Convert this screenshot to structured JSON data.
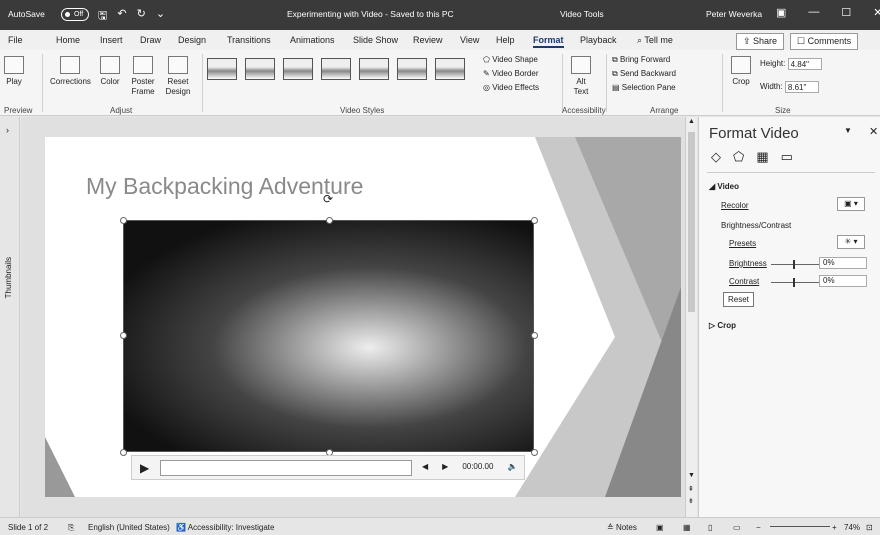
{
  "titlebar": {
    "autosave": "AutoSave",
    "toggle": "Off",
    "title": "Experimenting with Video  -  Saved to this PC",
    "tools": "Video Tools",
    "user": "Peter Weverka"
  },
  "tabs": [
    "File",
    "Home",
    "Insert",
    "Draw",
    "Design",
    "Transitions",
    "Animations",
    "Slide Show",
    "Review",
    "View",
    "Help",
    "Format",
    "Playback"
  ],
  "tell_me": "Tell me",
  "share": "Share",
  "comments": "Comments",
  "ribbon": {
    "play": "Play",
    "corrections": "Corrections",
    "color": "Color",
    "poster": "Poster Frame",
    "reset_design": "Reset Design",
    "video_shape": "Video Shape",
    "video_border": "Video Border",
    "video_effects": "Video Effects",
    "alt_text": "Alt Text",
    "bring_forward": "Bring Forward",
    "send_backward": "Send Backward",
    "selection_pane": "Selection Pane",
    "crop": "Crop",
    "height_label": "Height:",
    "height_value": "4.84\"",
    "width_label": "Width:",
    "width_value": "8.61\"",
    "groups": {
      "preview": "Preview",
      "adjust": "Adjust",
      "video_styles": "Video Styles",
      "accessibility": "Accessibility",
      "arrange": "Arrange",
      "size": "Size"
    }
  },
  "thumbnails": "Thumbnails",
  "slide": {
    "title": "My Backpacking Adventure",
    "time": "00:00.00"
  },
  "pane": {
    "title": "Format Video",
    "video_section": "Video",
    "recolor": "Recolor",
    "brightness_contrast": "Brightness/Contrast",
    "presets": "Presets",
    "brightness": "Brightness",
    "brightness_value": "0%",
    "contrast": "Contrast",
    "contrast_value": "0%",
    "reset": "Reset",
    "crop": "Crop"
  },
  "status": {
    "slide": "Slide 1 of 2",
    "language": "English (United States)",
    "accessibility": "Accessibility: Investigate",
    "notes": "Notes",
    "zoom": "74%"
  }
}
